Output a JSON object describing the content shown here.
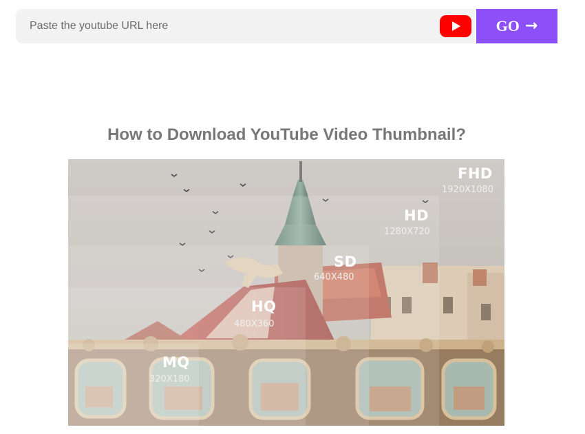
{
  "search": {
    "placeholder": "Paste the youtube URL here",
    "value": "",
    "submit_label": "GO",
    "submit_icon": "arrow-right-icon",
    "source_icon": "youtube-play-icon"
  },
  "colors": {
    "accent": "#8d4ff7",
    "youtube_red": "#ff0000",
    "input_bg": "#f2f2f2",
    "title_gray": "#777777"
  },
  "section": {
    "title": "How to Download YouTube Video Thumbnail?"
  },
  "thumbnail": {
    "resolutions": [
      {
        "name": "FHD",
        "size": "1920X1080"
      },
      {
        "name": "HD",
        "size": "1280X720"
      },
      {
        "name": "SD",
        "size": "640X480"
      },
      {
        "name": "HQ",
        "size": "480X360"
      },
      {
        "name": "MQ",
        "size": "320X180"
      }
    ]
  }
}
